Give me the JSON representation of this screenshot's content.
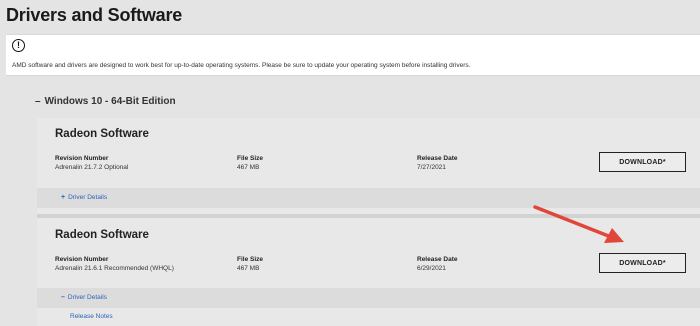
{
  "page": {
    "title": "Drivers and Software"
  },
  "notice": {
    "icon": "alert-circle-icon",
    "text": "AMD software and drivers are designed to work best for up-to-date operating systems. Please be sure to update your operating system before installing drivers."
  },
  "section": {
    "collapse_symbol": "–",
    "heading": "Windows 10 - 64-Bit Edition"
  },
  "drivers": [
    {
      "title": "Radeon Software",
      "revision_label": "Revision Number",
      "revision": "Adrenalin 21.7.2 Optional",
      "size_label": "File Size",
      "size": "467 MB",
      "date_label": "Release Date",
      "date": "7/27/2021",
      "download_label": "DOWNLOAD*",
      "details_symbol": "+",
      "details_label": "Driver Details"
    },
    {
      "title": "Radeon Software",
      "revision_label": "Revision Number",
      "revision": "Adrenalin 21.6.1 Recommended (WHQL)",
      "size_label": "File Size",
      "size": "467 MB",
      "date_label": "Release Date",
      "date": "6/29/2021",
      "download_label": "DOWNLOAD*",
      "details_symbol": "–",
      "details_label": "Driver Details",
      "release_notes_label": "Release Notes"
    }
  ],
  "annotation": {
    "arrow_color": "#e0463a"
  }
}
